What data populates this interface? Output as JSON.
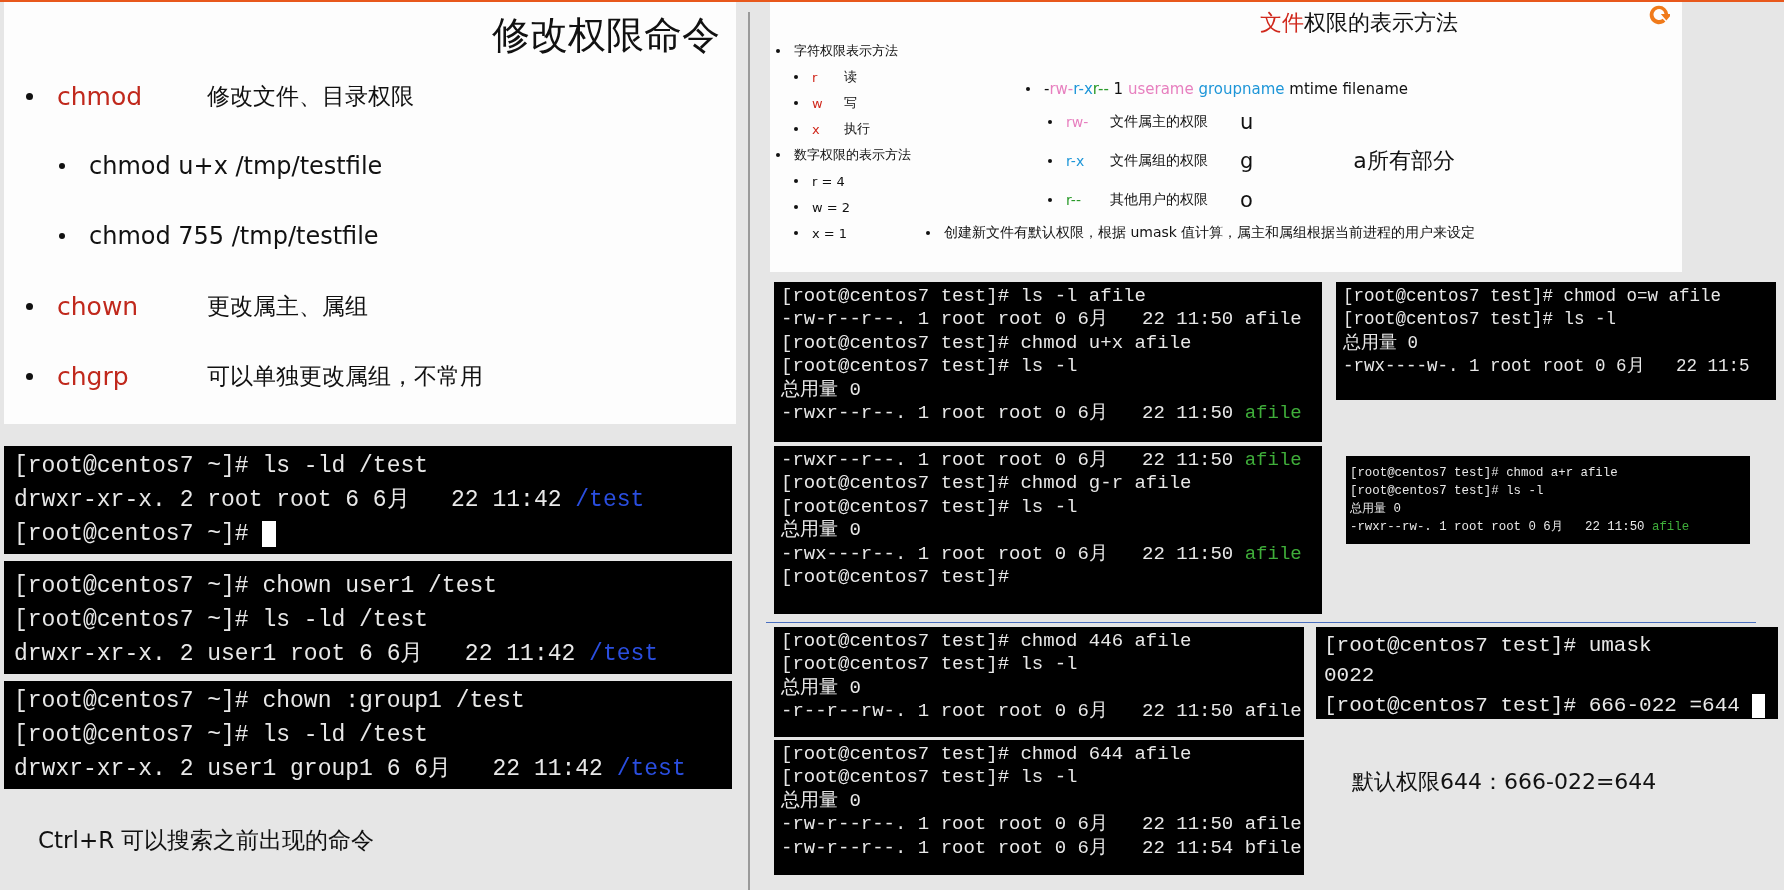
{
  "slide_left": {
    "title": "修改权限命令",
    "items": [
      {
        "command": "chmod",
        "description": "修改文件、目录权限",
        "children": [
          {
            "text": "chmod u+x /tmp/testfile"
          },
          {
            "text": "chmod 755 /tmp/testfile"
          }
        ]
      },
      {
        "command": "chown",
        "description": "更改属主、属组"
      },
      {
        "command": "chgrp",
        "description": "可以单独更改属组，不常用"
      }
    ]
  },
  "terminals_left": [
    {
      "lines": [
        {
          "text": "[root@centos7 ~]# ls -ld /test"
        },
        {
          "text": "drwxr-xr-x. 2 root root 6 6月   22 11:42",
          "file": "/test",
          "color": "#2a4ee0"
        },
        {
          "text": "[root@centos7 ~]#",
          "cursor": true
        }
      ]
    },
    {
      "lines": [
        {
          "text": "[root@centos7 ~]# chown user1 /test"
        },
        {
          "text": "[root@centos7 ~]# ls -ld /test"
        },
        {
          "text": "drwxr-xr-x. 2 user1 root 6 6月   22 11:42",
          "file": "/test",
          "color": "#2a4ee0"
        }
      ]
    },
    {
      "lines": [
        {
          "text": "[root@centos7 ~]# chown :group1 /test"
        },
        {
          "text": "[root@centos7 ~]# ls -ld /test"
        },
        {
          "text": "drwxr-xr-x. 2 user1 group1 6 6月   22 11:42",
          "file": "/test",
          "color": "#2a4ee0"
        }
      ]
    }
  ],
  "note": "Ctrl+R 可以搜索之前出现的命令",
  "slide_right": {
    "title": [
      {
        "text": "文件",
        "kind": "accent"
      },
      {
        "text": "权限的表示方法",
        "kind": "plain"
      }
    ],
    "notation": [
      {
        "text": "字符权限表示方法",
        "children": [
          {
            "symbol": "r",
            "meaning": "读"
          },
          {
            "symbol": "w",
            "meaning": "写"
          },
          {
            "symbol": "x",
            "meaning": "执行"
          }
        ]
      },
      {
        "text": "数字权限的表示方法",
        "children": [
          {
            "symbol": "r = 4"
          },
          {
            "symbol": "w = 2"
          },
          {
            "symbol": "x = 1"
          }
        ]
      }
    ],
    "format": [
      {
        "text": "-",
        "kind": "plain"
      },
      {
        "text": "rw-",
        "kind": "owner"
      },
      {
        "text": "r-x",
        "kind": "group"
      },
      {
        "text": "r--",
        "kind": "other"
      },
      {
        "text": " 1 ",
        "kind": "plain"
      },
      {
        "text": "userame",
        "kind": "owner"
      },
      {
        "text": " groupname",
        "kind": "group"
      },
      {
        "text": " mtime  filename",
        "kind": "plain"
      }
    ],
    "permissions": [
      {
        "symbol": "rw-",
        "kind": "owner",
        "meaning": "文件属主的权限",
        "letter": "u"
      },
      {
        "symbol": "r-x",
        "kind": "group",
        "meaning": "文件属组的权限",
        "letter": "g"
      },
      {
        "symbol": "r--",
        "kind": "other",
        "meaning": "其他用户的权限",
        "letter": "o"
      }
    ],
    "all_note": "a所有部分",
    "umask_note": "创建新文件有默认权限，根据 umask 值计算，属主和属组根据当前进程的用户来设定"
  },
  "terminals_right": [
    {
      "lines": [
        {
          "text": "[root@centos7 test]# ls -l afile"
        },
        {
          "text": "-rw-r--r--. 1 root root 0 6月   22 11:50 afile"
        },
        {
          "text": "[root@centos7 test]# chmod u+x afile"
        },
        {
          "text": "[root@centos7 test]# ls -l"
        },
        {
          "text": "总用量 0"
        },
        {
          "text": "-rwxr--r--. 1 root root 0 6月   22 11:50",
          "file": "afile",
          "color": "#3fae3a"
        }
      ]
    },
    {
      "lines": [
        {
          "text": "[root@centos7 test]# chmod o=w afile"
        },
        {
          "text": "[root@centos7 test]# ls -l"
        },
        {
          "text": "总用量 0"
        },
        {
          "text": "-rwx----w-. 1 root root 0 6月   22 11:5"
        }
      ]
    },
    {
      "lines": [
        {
          "text": "-rwxr--r--. 1 root root 0 6月   22 11:50",
          "file": "afile",
          "color": "#3fae3a"
        },
        {
          "text": "[root@centos7 test]# chmod g-r afile"
        },
        {
          "text": "[root@centos7 test]# ls -l"
        },
        {
          "text": "总用量 0"
        },
        {
          "text": "-rwx---r--. 1 root root 0 6月   22 11:50",
          "file": "afile",
          "color": "#3fae3a"
        },
        {
          "text": "[root@centos7 test]#"
        }
      ]
    },
    {
      "lines": [
        {
          "text": "[root@centos7 test]# chmod a+r afile"
        },
        {
          "text": "[root@centos7 test]# ls -l"
        },
        {
          "text": "总用量 0"
        },
        {
          "text": "-rwxr--rw-. 1 root root 0 6月   22 11:50",
          "file": "afile",
          "color": "#3fae3a"
        }
      ]
    },
    {
      "lines": [
        {
          "text": "[root@centos7 test]# chmod 446 afile"
        },
        {
          "text": "[root@centos7 test]# ls -l"
        },
        {
          "text": "总用量 0"
        },
        {
          "text": "-r--r--rw-. 1 root root 0 6月   22 11:50 afile"
        }
      ]
    },
    {
      "lines": [
        {
          "text": "[root@centos7 test]# chmod 644 afile"
        },
        {
          "text": "[root@centos7 test]# ls -l"
        },
        {
          "text": "总用量 0"
        },
        {
          "text": "-rw-r--r--. 1 root root 0 6月   22 11:50 afile"
        },
        {
          "text": "-rw-r--r--. 1 root root 0 6月   22 11:54 bfile"
        }
      ]
    },
    {
      "lines": [
        {
          "text": "[root@centos7 test]# umask"
        },
        {
          "text": "0022"
        },
        {
          "text": "[root@centos7 test]# 666-022 =644",
          "cursor": true
        }
      ]
    }
  ],
  "default_note": "默认权限644：666-022=644"
}
